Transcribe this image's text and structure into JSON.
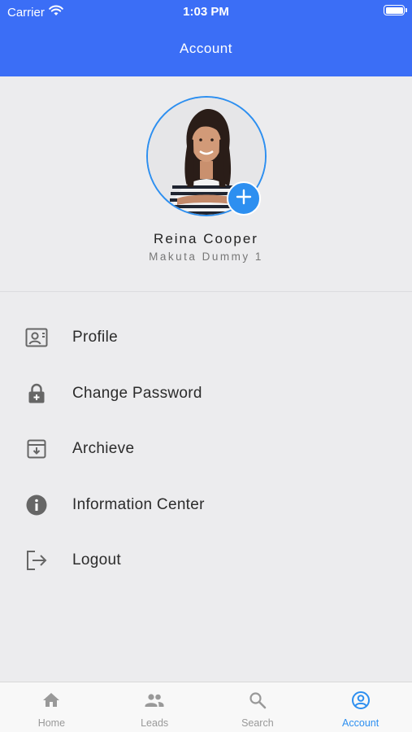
{
  "status_bar": {
    "carrier": "Carrier",
    "time": "1:03 PM"
  },
  "header": {
    "title": "Account"
  },
  "profile": {
    "name": "Reina Cooper",
    "subtitle": "Makuta Dummy 1"
  },
  "menu": {
    "items": [
      {
        "label": "Profile",
        "icon": "profile-card-icon"
      },
      {
        "label": "Change Password",
        "icon": "lock-icon"
      },
      {
        "label": "Archieve",
        "icon": "archive-icon"
      },
      {
        "label": "Information Center",
        "icon": "info-icon"
      },
      {
        "label": "Logout",
        "icon": "logout-icon"
      }
    ]
  },
  "tabbar": {
    "tabs": [
      {
        "label": "Home",
        "icon": "home-icon"
      },
      {
        "label": "Leads",
        "icon": "people-icon"
      },
      {
        "label": "Search",
        "icon": "search-icon"
      },
      {
        "label": "Account",
        "icon": "account-circle-icon",
        "active": true
      }
    ]
  },
  "colors": {
    "header": "#3b6ef6",
    "accent": "#2d8ff0",
    "background": "#ececee",
    "icon_gray": "#666666"
  }
}
